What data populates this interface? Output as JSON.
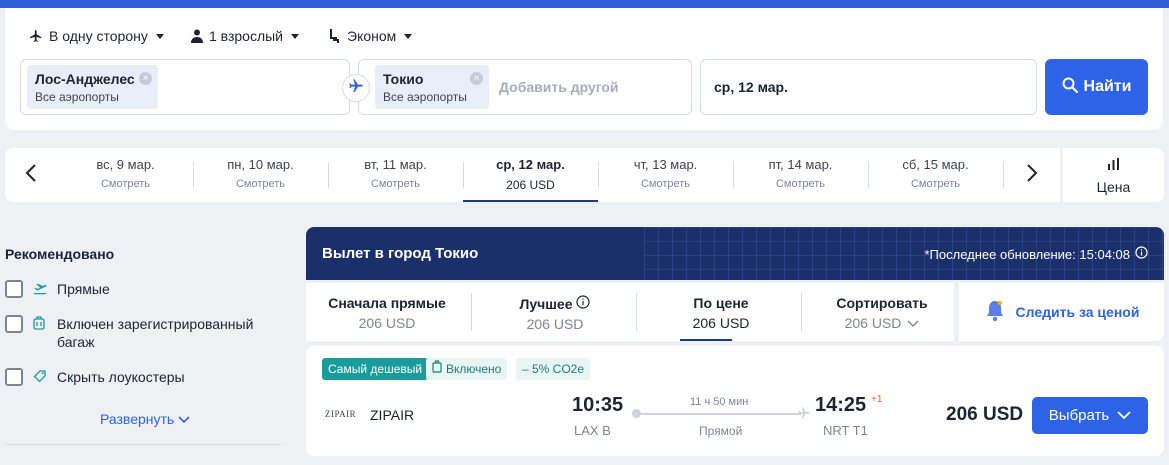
{
  "search": {
    "trip_type": "В одну сторону",
    "passengers": "1 взрослый",
    "cabin": "Эконом",
    "origin": {
      "city": "Лос-Анджелес",
      "airports": "Все аэропорты"
    },
    "destination": {
      "city": "Токио",
      "airports": "Все аэропорты"
    },
    "add_other": "Добавить другой",
    "date": "ср, 12 мар.",
    "search_button": "Найти"
  },
  "date_strip": {
    "days": [
      {
        "date": "вс, 9 мар.",
        "sub": "Смотреть"
      },
      {
        "date": "пн, 10 мар.",
        "sub": "Смотреть"
      },
      {
        "date": "вт, 11 мар.",
        "sub": "Смотреть"
      },
      {
        "date": "ср, 12 мар.",
        "sub": "206 USD"
      },
      {
        "date": "чт, 13 мар.",
        "sub": "Смотреть"
      },
      {
        "date": "пт, 14 мар.",
        "sub": "Смотреть"
      },
      {
        "date": "сб, 15 мар.",
        "sub": "Смотреть"
      }
    ],
    "price_label": "Цена"
  },
  "filters": {
    "title": "Рекомендовано",
    "items": [
      {
        "label": "Прямые",
        "icon": "takeoff-icon"
      },
      {
        "label": "Включен зарегистрированный багаж",
        "icon": "luggage-icon"
      },
      {
        "label": "Скрыть лоукостеры",
        "icon": "tag-icon"
      }
    ],
    "expand": "Развернуть"
  },
  "results": {
    "title": "Вылет в город Токио",
    "updated": "*Последнее обновление: 15:04:08",
    "sort_tabs": [
      {
        "label": "Сначала прямые",
        "price": "206 USD"
      },
      {
        "label": "Лучшее",
        "price": "206 USD"
      },
      {
        "label": "По цене",
        "price": "206 USD"
      },
      {
        "label": "Сортировать",
        "price": "206 USD"
      }
    ],
    "watch_price": "Следить за ценой"
  },
  "flight": {
    "tags": {
      "cheapest": "Самый дешевый",
      "included": "Включено",
      "co2": "– 5% CO2e"
    },
    "airline_logo": "ZIPAIR",
    "airline": "ZIPAIR",
    "departure_time": "10:35",
    "departure_airport": "LAX B",
    "duration": "11 ч 50 мин",
    "stops": "Прямой",
    "arrival_time": "14:25",
    "arrival_plus": "+1",
    "arrival_airport": "NRT T1",
    "price": "206 USD",
    "select_button": "Выбрать"
  },
  "colors": {
    "accent": "#2e63e8",
    "header": "#1b2f6b",
    "cheapest_tag": "#1a9c9a"
  }
}
